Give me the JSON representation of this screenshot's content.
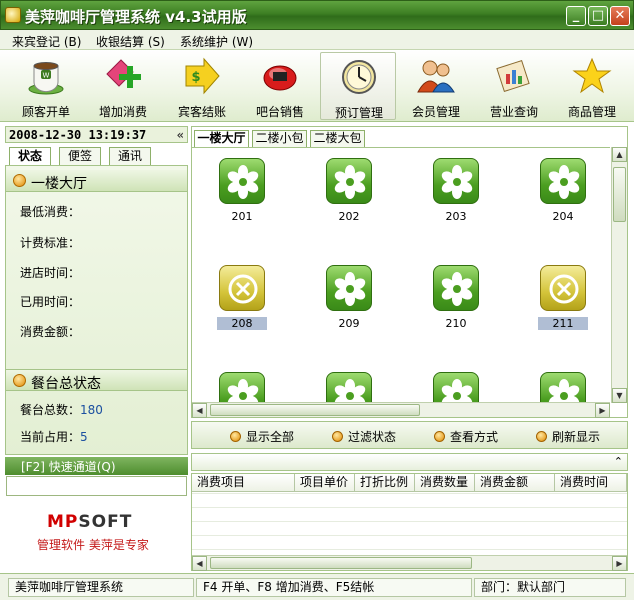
{
  "window": {
    "title": "美萍咖啡厅管理系统 v4.3试用版",
    "controls": [
      "minimize",
      "maximize",
      "close"
    ]
  },
  "menu": [
    {
      "label": "来宾登记 (B)"
    },
    {
      "label": "收银结算 (S)"
    },
    {
      "label": "系统维护 (W)"
    }
  ],
  "toolbar": [
    {
      "label": "顾客开单",
      "icon": "coffee-cup-icon"
    },
    {
      "label": "增加消费",
      "icon": "add-tag-icon"
    },
    {
      "label": "宾客结账",
      "icon": "checkout-arrow-icon"
    },
    {
      "label": "吧台销售",
      "icon": "bar-sales-icon"
    },
    {
      "label": "预订管理",
      "icon": "clock-icon"
    },
    {
      "label": "会员管理",
      "icon": "members-icon"
    },
    {
      "label": "营业查询",
      "icon": "chart-query-icon"
    },
    {
      "label": "商品管理",
      "icon": "star-icon"
    }
  ],
  "left": {
    "datetime": "2008-12-30 13:19:37",
    "collapse": "«",
    "tabs": [
      "状态",
      "便签",
      "通讯"
    ],
    "section1": {
      "title": "一楼大厅",
      "fields": [
        {
          "label": "最低消费：",
          "value": ""
        },
        {
          "label": "计费标准：",
          "value": ""
        },
        {
          "label": "进店时间：",
          "value": ""
        },
        {
          "label": "已用时间：",
          "value": ""
        },
        {
          "label": "消费金额：",
          "value": ""
        }
      ]
    },
    "section2": {
      "title": "餐台总状态",
      "fields": [
        {
          "label": "餐台总数：",
          "value": "180"
        },
        {
          "label": "当前占用：",
          "value": "5"
        }
      ]
    },
    "quick_channel": "[F2] 快速通道(Q)",
    "logo": {
      "mark": "MP",
      "text": "SOFT",
      "slogan": "管理软件 美萍是专家"
    }
  },
  "rooms": {
    "tabs": [
      "一楼大厅",
      "二楼小包",
      "二楼大包"
    ],
    "rows": [
      [
        {
          "num": "201",
          "status": "free"
        },
        {
          "num": "202",
          "status": "free"
        },
        {
          "num": "203",
          "status": "free"
        },
        {
          "num": "204",
          "status": "free"
        }
      ],
      [
        {
          "num": "208",
          "status": "occupied"
        },
        {
          "num": "209",
          "status": "free"
        },
        {
          "num": "210",
          "status": "free"
        },
        {
          "num": "211",
          "status": "occupied"
        }
      ],
      [
        {
          "num": "",
          "status": "free"
        },
        {
          "num": "",
          "status": "free"
        },
        {
          "num": "",
          "status": "free"
        },
        {
          "num": "",
          "status": "free"
        }
      ]
    ]
  },
  "actions": [
    "显示全部",
    "过滤状态",
    "查看方式",
    "刷新显示"
  ],
  "consumption": {
    "expand": "⌃",
    "columns": [
      "消费项目",
      "项目单价",
      "打折比例",
      "消费数量",
      "消费金额",
      "消费时间"
    ]
  },
  "status": {
    "app": "美萍咖啡厅管理系统",
    "hint": "F4 开单、F8 增加消费、F5结帐",
    "dept": "部门：默认部门"
  },
  "colors": {
    "accent": "#4b9e20",
    "free": "#4b9e20",
    "occupied": "#d4c43a"
  }
}
